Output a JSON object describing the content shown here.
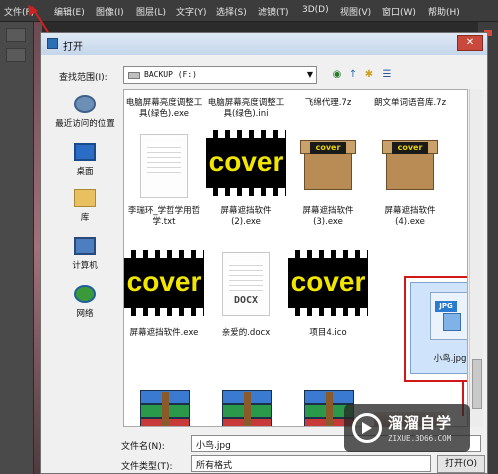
{
  "menubar": {
    "items": [
      "文件(F)",
      "编辑(E)",
      "图像(I)",
      "图层(L)",
      "文字(Y)",
      "选择(S)",
      "滤镜(T)",
      "3D(D)",
      "视图(V)",
      "窗口(W)",
      "帮助(H)"
    ]
  },
  "dialog": {
    "title": "打开",
    "close_symbol": "✕",
    "lookin_label": "查找范围(I):",
    "lookin_value": "BACKUP (F:)",
    "dropdown_symbol": "▼",
    "nav": [
      "◉",
      "↑",
      "✱",
      "☰"
    ],
    "places": [
      {
        "label": "最近访问的位置",
        "icon": "recent-places-icon"
      },
      {
        "label": "桌面",
        "icon": "desktop-icon"
      },
      {
        "label": "库",
        "icon": "library-icon"
      },
      {
        "label": "计算机",
        "icon": "computer-icon"
      },
      {
        "label": "网络",
        "icon": "network-icon"
      }
    ],
    "files": {
      "row0": [
        "电脑屏幕亮度调整工具(绿色).exe",
        "电脑屏幕亮度调整工具(绿色).ini",
        "飞绵代理.7z",
        "朗文单词语音库.7z"
      ],
      "row1": [
        "李瑞环_学哲学用哲学.txt",
        "屏幕遮挡软件(2).exe",
        "屏幕遮挡软件(3).exe",
        "屏幕遮挡软件(4).exe"
      ],
      "row2": [
        "屏幕遮挡软件.exe",
        "亲爱的.docx",
        "项目4.ico",
        "小鸟.jpg"
      ]
    },
    "cover_word": "cover",
    "docx_word": "DOCX",
    "jpg_tag": "JPG",
    "filename_label": "文件名(N):",
    "filename_value": "小鸟.jpg",
    "filetype_label": "文件类型(T):",
    "filetype_value": "所有格式",
    "open_button": "打开(O)"
  },
  "watermark": {
    "title": "溜溜自学",
    "url": "ZIXUE.3D66.COM"
  }
}
